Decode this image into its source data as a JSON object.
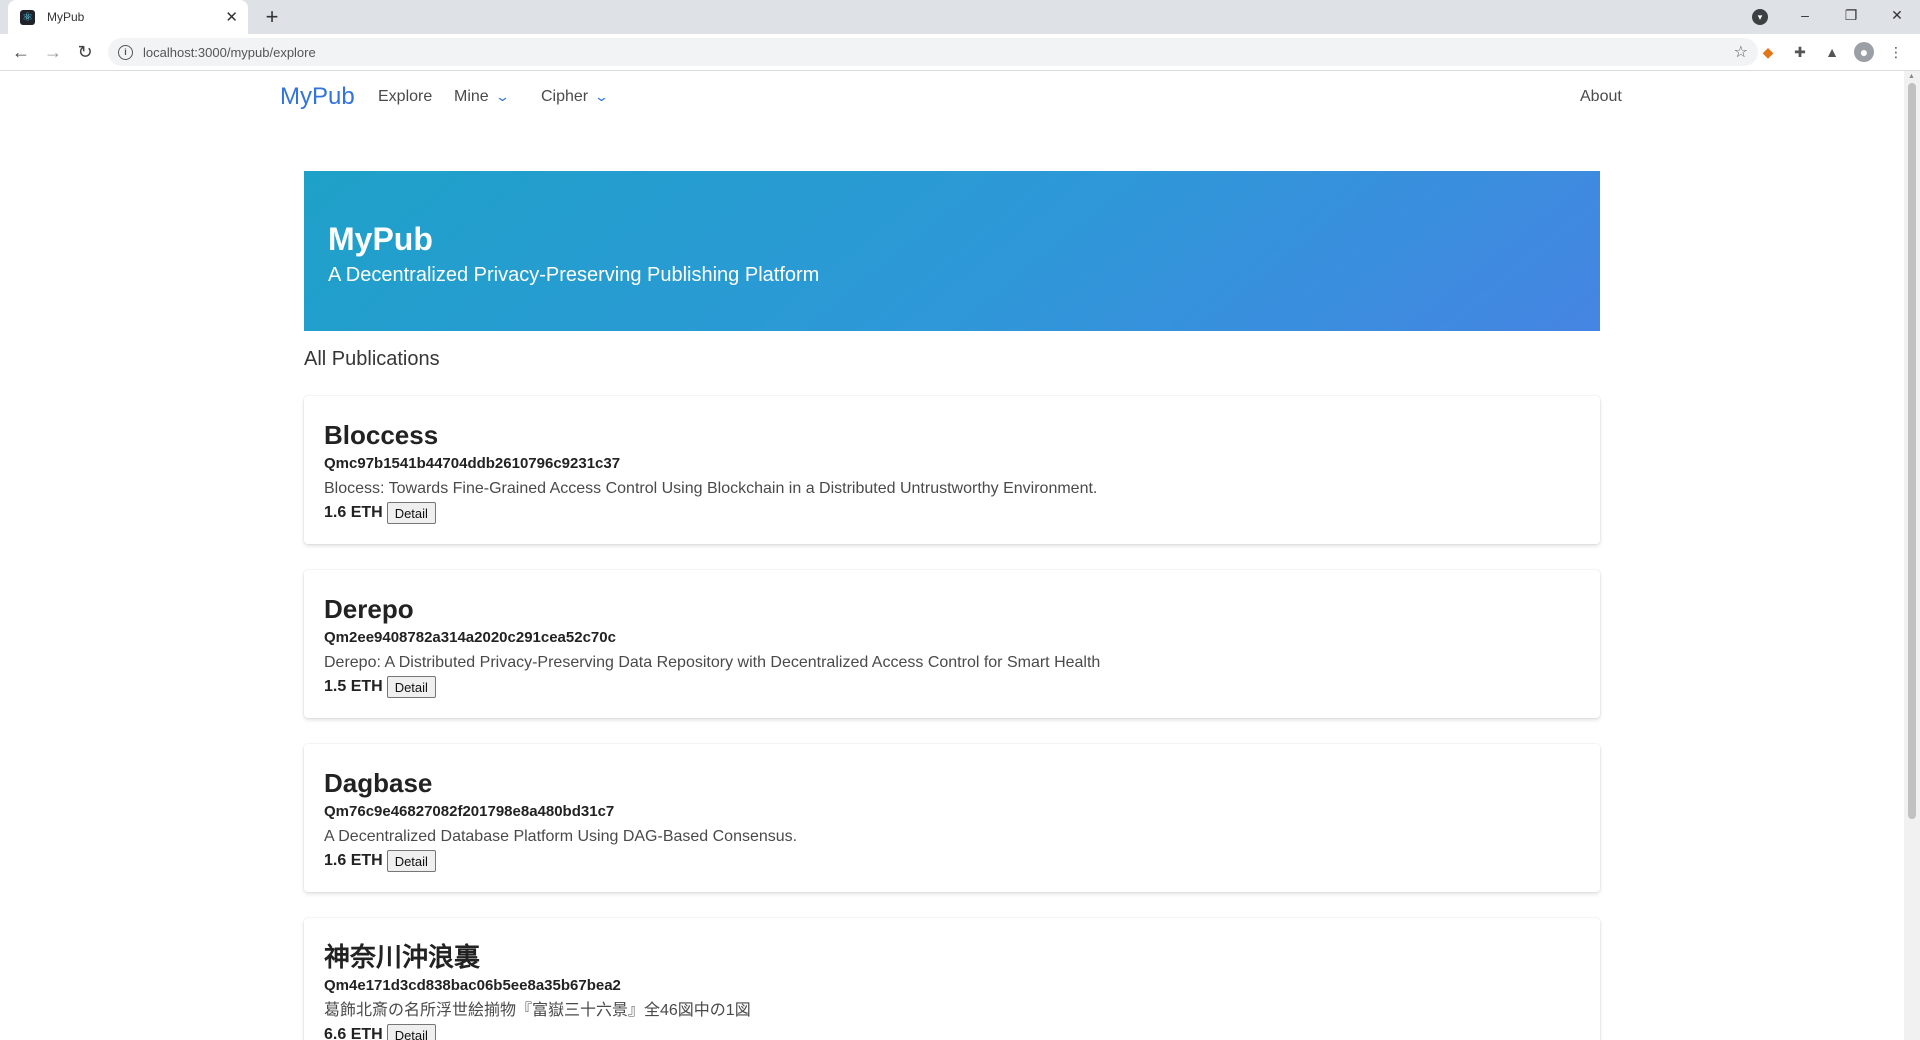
{
  "browser": {
    "tab_title": "MyPub",
    "url": "localhost:3000/mypub/explore"
  },
  "navbar": {
    "brand": "MyPub",
    "links": [
      "Explore",
      "Mine",
      "Cipher"
    ],
    "about": "About",
    "brand_color": "#3273dc"
  },
  "hero": {
    "title": "MyPub",
    "subtitle": "A Decentralized Privacy-Preserving Publishing Platform"
  },
  "section_title": "All Publications",
  "publications": [
    {
      "title": "Bloccess",
      "hash": "Qmc97b1541b44704ddb2610796c9231c37",
      "description": "Blocess: Towards Fine-Grained Access Control Using Blockchain in a Distributed Untrustworthy Environment.",
      "price": "1.6 ETH",
      "button": "Detail"
    },
    {
      "title": "Derepo",
      "hash": "Qm2ee9408782a314a2020c291cea52c70c",
      "description": "Derepo: A Distributed Privacy-Preserving Data Repository with Decentralized Access Control for Smart Health",
      "price": "1.5 ETH",
      "button": "Detail"
    },
    {
      "title": "Dagbase",
      "hash": "Qm76c9e46827082f201798e8a480bd31c7",
      "description": "A Decentralized Database Platform Using DAG-Based Consensus.",
      "price": "1.6 ETH",
      "button": "Detail"
    },
    {
      "title": "神奈川沖浪裏",
      "hash": "Qm4e171d3cd838bac06b5ee8a35b67bea2",
      "description": "葛飾北斎の名所浮世絵揃物『富嶽三十六景』全46図中の1図",
      "price": "6.6 ETH",
      "button": "Detail"
    }
  ]
}
